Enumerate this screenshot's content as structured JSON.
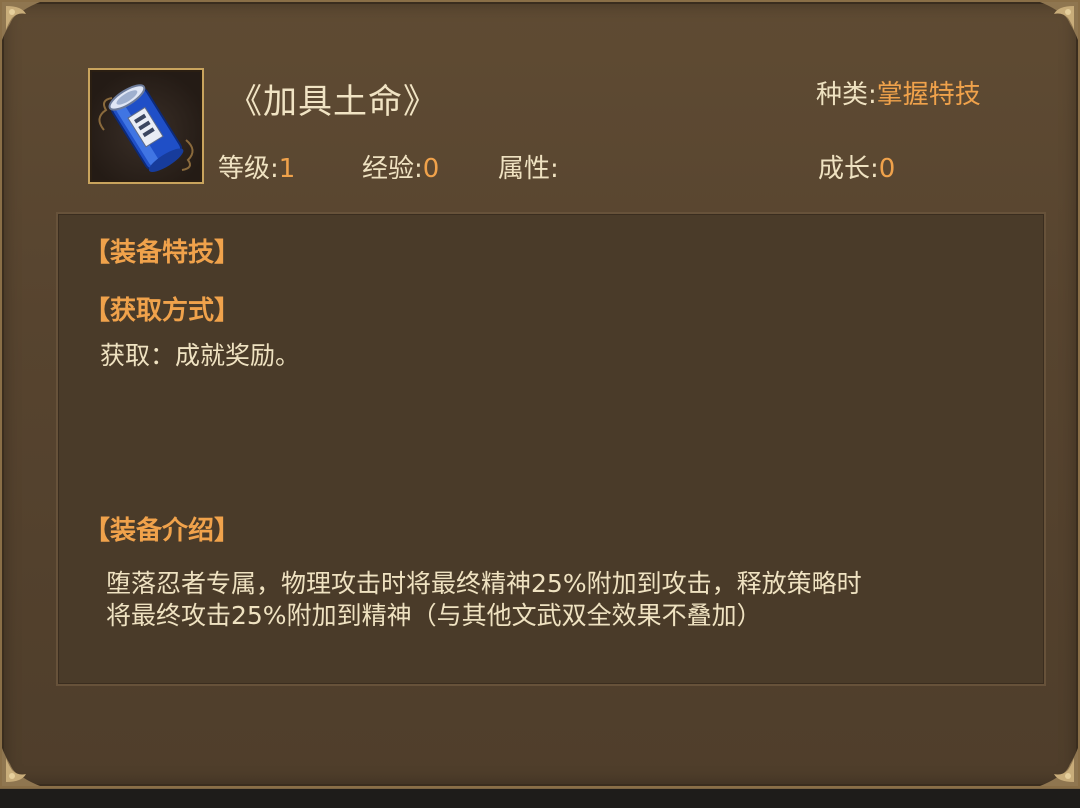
{
  "item": {
    "name": "《加具土命》",
    "icon": "blue-scroll-icon"
  },
  "stats": {
    "type_label": "种类:",
    "type_value": "掌握特技",
    "level_label": "等级:",
    "level_value": "1",
    "exp_label": "经验:",
    "exp_value": "0",
    "attr_label": "属性:",
    "attr_value": "",
    "growth_label": "成长:",
    "growth_value": "0"
  },
  "sections": {
    "equip_skill_title": "【装备特技】",
    "acquire_title": "【获取方式】",
    "acquire_text": "获取：成就奖励。",
    "intro_title": "【装备介绍】",
    "intro_line1": "堕落忍者专属，物理攻击时将最终精神25%附加到攻击，释放策略时",
    "intro_line2": "将最终攻击25%附加到精神（与其他文武双全效果不叠加）"
  },
  "colors": {
    "accent": "#f0a24b",
    "text": "#efe2c1",
    "panel": "#4a3b29",
    "frame": "#57442f"
  }
}
